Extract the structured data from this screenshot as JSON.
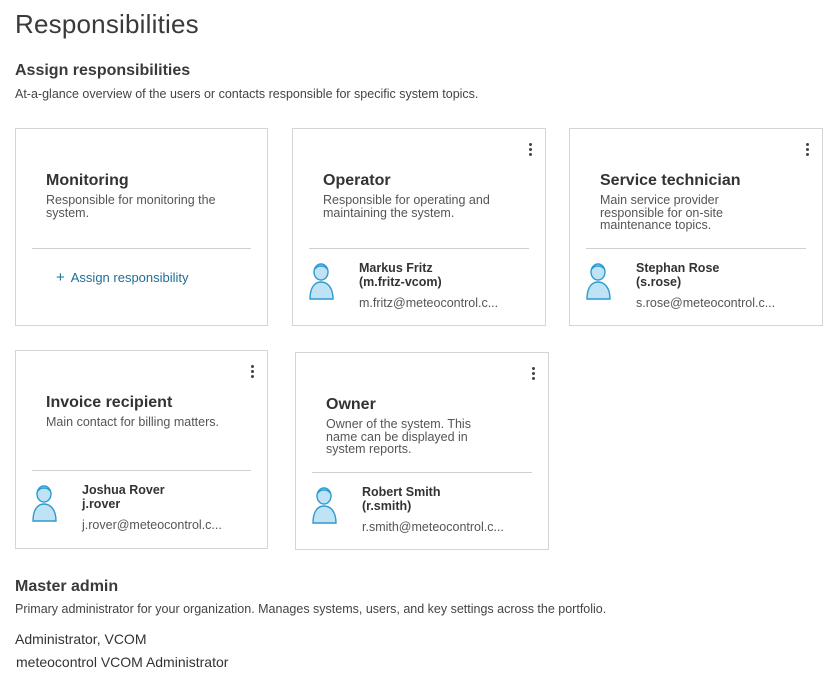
{
  "page": {
    "title": "Responsibilities",
    "section_title": "Assign responsibilities",
    "section_desc": "At-a-glance overview of the users or contacts responsible for specific system topics."
  },
  "cards": {
    "monitoring": {
      "title": "Monitoring",
      "desc": "Responsible for monitoring the system.",
      "assign_label": "Assign responsibility"
    },
    "operator": {
      "title": "Operator",
      "desc": "Responsible for operating and maintaining the system.",
      "person_name": "Markus Fritz",
      "person_login": "(m.fritz-vcom)",
      "person_email": "m.fritz@meteocontrol.c..."
    },
    "service": {
      "title": "Service technician",
      "desc": "Main service provider responsible for on-site maintenance topics.",
      "person_name": "Stephan Rose",
      "person_login": "(s.rose)",
      "person_email": "s.rose@meteocontrol.c..."
    },
    "invoice": {
      "title": "Invoice recipient",
      "desc": "Main contact for billing matters.",
      "person_name": "Joshua Rover",
      "person_login": "j.rover",
      "person_email": "j.rover@meteocontrol.c..."
    },
    "owner": {
      "title": "Owner",
      "desc": "Owner of the system. This name can be displayed in system reports.",
      "person_name": "Robert Smith",
      "person_login": "(r.smith)",
      "person_email": "r.smith@meteocontrol.c..."
    }
  },
  "master_admin": {
    "title": "Master admin",
    "desc": "Primary administrator for your organization. Manages systems, users, and key settings across the portfolio.",
    "role": "Administrator, VCOM",
    "name": "meteocontrol VCOM Administrator"
  },
  "icons": {
    "avatar": "user-avatar-icon",
    "menu": "more-vertical-icon",
    "plus": "plus-icon"
  },
  "colors": {
    "link": "#1f6e97",
    "avatar_fill": "#bfe3f5",
    "avatar_stroke": "#2b9bd1"
  }
}
